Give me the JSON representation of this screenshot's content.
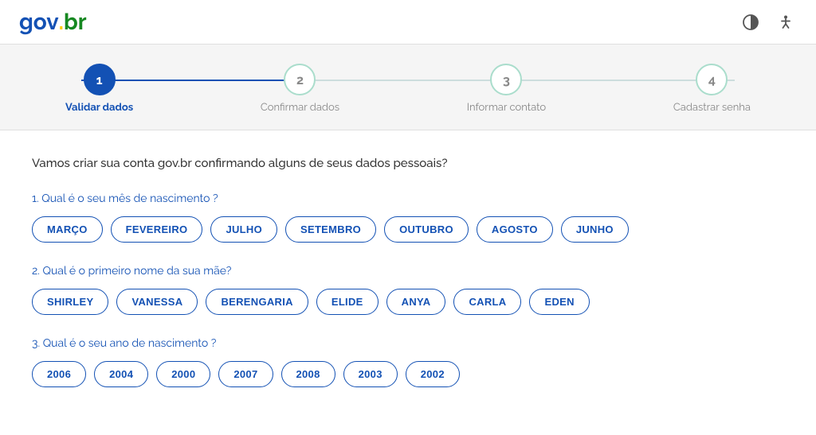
{
  "header": {
    "logo": {
      "gov": "gov",
      "dot": ".",
      "br": "br"
    },
    "icons": [
      "contrast-icon",
      "accessibility-icon"
    ]
  },
  "progress": {
    "steps": [
      {
        "number": "1",
        "label": "Validar dados",
        "active": true
      },
      {
        "number": "2",
        "label": "Confirmar dados",
        "active": false
      },
      {
        "number": "3",
        "label": "Informar contato",
        "active": false
      },
      {
        "number": "4",
        "label": "Cadastrar senha",
        "active": false
      }
    ]
  },
  "main": {
    "intro": "Vamos criar sua conta gov.br confirmando alguns de seus dados pessoais?",
    "questions": [
      {
        "id": "q1",
        "prefix": "1. Qual é o seu ",
        "highlight": "mês de nascimento",
        "suffix": " ?",
        "options": [
          "MARÇO",
          "FEVEREIRO",
          "JULHO",
          "SETEMBRO",
          "OUTUBRO",
          "AGOSTO",
          "JUNHO"
        ]
      },
      {
        "id": "q2",
        "prefix": "2. Qual é o ",
        "highlight": "primeiro nome da sua mãe",
        "suffix": "?",
        "options": [
          "SHIRLEY",
          "VANESSA",
          "BERENGARIA",
          "ELIDE",
          "ANYA",
          "CARLA",
          "EDEN"
        ]
      },
      {
        "id": "q3",
        "prefix": "3. Qual é o seu ",
        "highlight": "ano de nascimento",
        "suffix": " ?",
        "options": [
          "2006",
          "2004",
          "2000",
          "2007",
          "2008",
          "2003",
          "2002"
        ]
      }
    ]
  }
}
